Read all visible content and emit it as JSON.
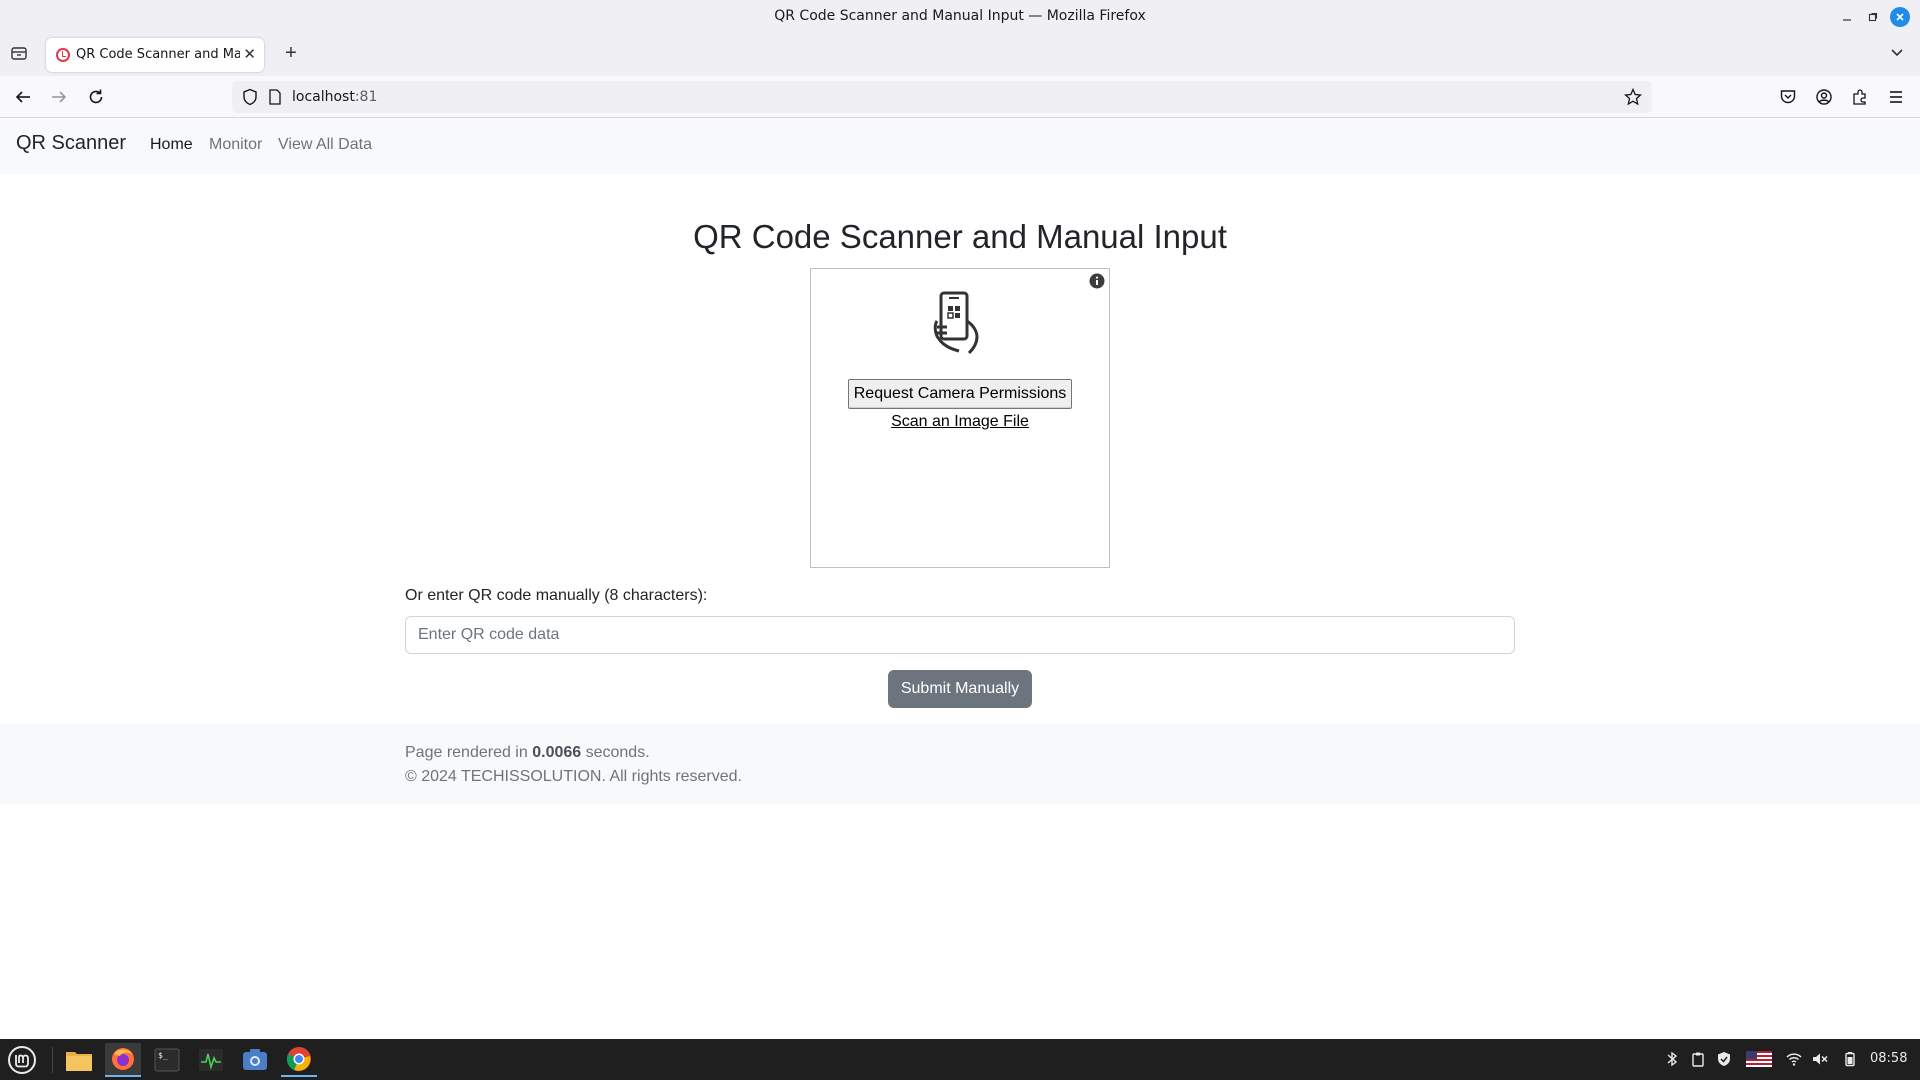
{
  "window": {
    "title": "QR Code Scanner and Manual Input — Mozilla Firefox"
  },
  "browser": {
    "tab_title": "QR Code Scanner and Manual Input",
    "url_host": "localhost",
    "url_port": ":81"
  },
  "site_nav": {
    "brand": "QR Scanner",
    "links": [
      {
        "label": "Home",
        "active": true
      },
      {
        "label": "Monitor",
        "active": false
      },
      {
        "label": "View All Data",
        "active": false
      }
    ]
  },
  "main": {
    "heading": "QR Code Scanner and Manual Input",
    "reader": {
      "camera_button": "Request Camera Permissions",
      "scan_file_link": "Scan an Image File"
    },
    "manual_label": "Or enter QR code manually (8 characters):",
    "input_placeholder": "Enter QR code data",
    "input_value": "",
    "submit_label": "Submit Manually"
  },
  "footer": {
    "render_prefix": "Page rendered in",
    "render_time": "0.0066",
    "render_suffix": "seconds.",
    "copyright": "© 2024 TECHISSOLUTION. All rights reserved."
  },
  "taskbar": {
    "clock": "08:58",
    "apps": [
      "mint-menu-icon",
      "files-icon",
      "firefox-icon",
      "terminal-icon",
      "system-monitor-icon",
      "screenshot-icon",
      "chrome-icon"
    ],
    "active_app": "firefox-icon"
  },
  "colors": {
    "accent_close": "#1f8ceb",
    "submit_button": "#6c757d",
    "navbar_bg": "#f8f9fa",
    "favicon": "#e0384b"
  }
}
